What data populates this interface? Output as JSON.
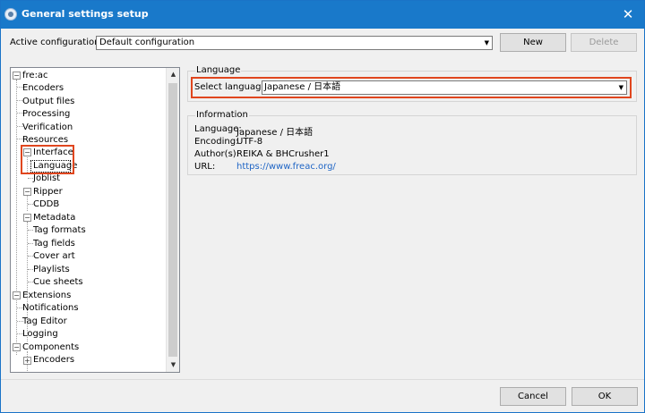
{
  "window": {
    "title": "General settings setup",
    "close_glyph": "✕"
  },
  "config": {
    "label": "Active configuration:",
    "value": "Default configuration",
    "new_label": "New",
    "delete_label": "Delete"
  },
  "tree": {
    "items": [
      {
        "label": "fre:ac",
        "expander": "−"
      },
      {
        "label": "Encoders"
      },
      {
        "label": "Output files"
      },
      {
        "label": "Processing"
      },
      {
        "label": "Verification"
      },
      {
        "label": "Resources"
      },
      {
        "label": "Interface",
        "expander": "−"
      },
      {
        "label": "Language",
        "selected": true
      },
      {
        "label": "Joblist"
      },
      {
        "label": "Ripper",
        "expander": "−"
      },
      {
        "label": "CDDB"
      },
      {
        "label": "Metadata",
        "expander": "−"
      },
      {
        "label": "Tag formats"
      },
      {
        "label": "Tag fields"
      },
      {
        "label": "Cover art"
      },
      {
        "label": "Playlists"
      },
      {
        "label": "Cue sheets"
      },
      {
        "label": "Extensions",
        "expander": "−"
      },
      {
        "label": "Notifications"
      },
      {
        "label": "Tag Editor"
      },
      {
        "label": "Logging"
      },
      {
        "label": "Components",
        "expander": "−"
      },
      {
        "label": "Encoders",
        "expander": "+"
      }
    ]
  },
  "language_group": {
    "title": "Language",
    "select_label": "Select language:",
    "select_value": "Japanese / 日本語"
  },
  "info_group": {
    "title": "Information",
    "rows": [
      {
        "key": "Language:",
        "value": "Japanese / 日本語"
      },
      {
        "key": "Encoding:",
        "value": "UTF-8"
      },
      {
        "key": "Author(s):",
        "value": "REIKA & BHCrusher1"
      },
      {
        "key": "URL:",
        "value": "https://www.freac.org/"
      }
    ]
  },
  "footer": {
    "cancel_label": "Cancel",
    "ok_label": "OK"
  },
  "colors": {
    "titlebar": "#1979ca",
    "highlight": "#e0461e",
    "selection_outline": "#000000",
    "link": "#1f65c5"
  },
  "icons": {
    "dropdown": "chevron-down-icon",
    "scroll_up": "scroll-up-icon",
    "scroll_down": "scroll-down-icon",
    "collapse": "minus-box-icon",
    "expand": "plus-box-icon"
  }
}
